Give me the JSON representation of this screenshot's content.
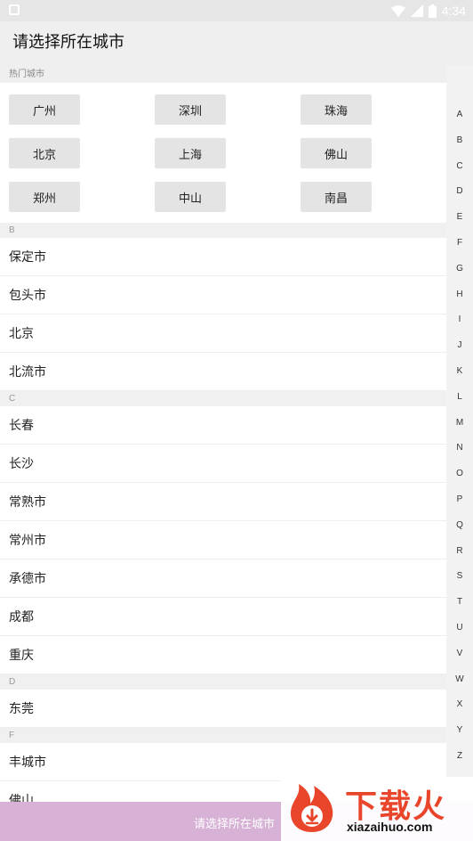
{
  "status_bar": {
    "time": "4:34"
  },
  "app_bar": {
    "title": "请选择所在城市"
  },
  "hot_section": {
    "title": "热门城市",
    "cities": [
      "广州",
      "深圳",
      "珠海",
      "北京",
      "上海",
      "佛山",
      "郑州",
      "中山",
      "南昌"
    ]
  },
  "groups": [
    {
      "letter": "B",
      "cities": [
        "保定市",
        "包头市",
        "北京",
        "北流市"
      ]
    },
    {
      "letter": "C",
      "cities": [
        "长春",
        "长沙",
        "常熟市",
        "常州市",
        "承德市",
        "成都",
        "重庆"
      ]
    },
    {
      "letter": "D",
      "cities": [
        "东莞"
      ]
    },
    {
      "letter": "F",
      "cities": [
        "丰城市",
        "佛山"
      ]
    }
  ],
  "index_letters": [
    "A",
    "B",
    "C",
    "D",
    "E",
    "F",
    "G",
    "H",
    "I",
    "J",
    "K",
    "L",
    "M",
    "N",
    "O",
    "P",
    "Q",
    "R",
    "S",
    "T",
    "U",
    "V",
    "W",
    "X",
    "Y",
    "Z"
  ],
  "bottom_bar": {
    "label": "请选择所在城市"
  },
  "watermark": {
    "brand": "下载火",
    "domain": "xiazaihuo.com"
  },
  "colors": {
    "bottom_bar": "#d7b1d6",
    "brand": "#e8452b"
  }
}
